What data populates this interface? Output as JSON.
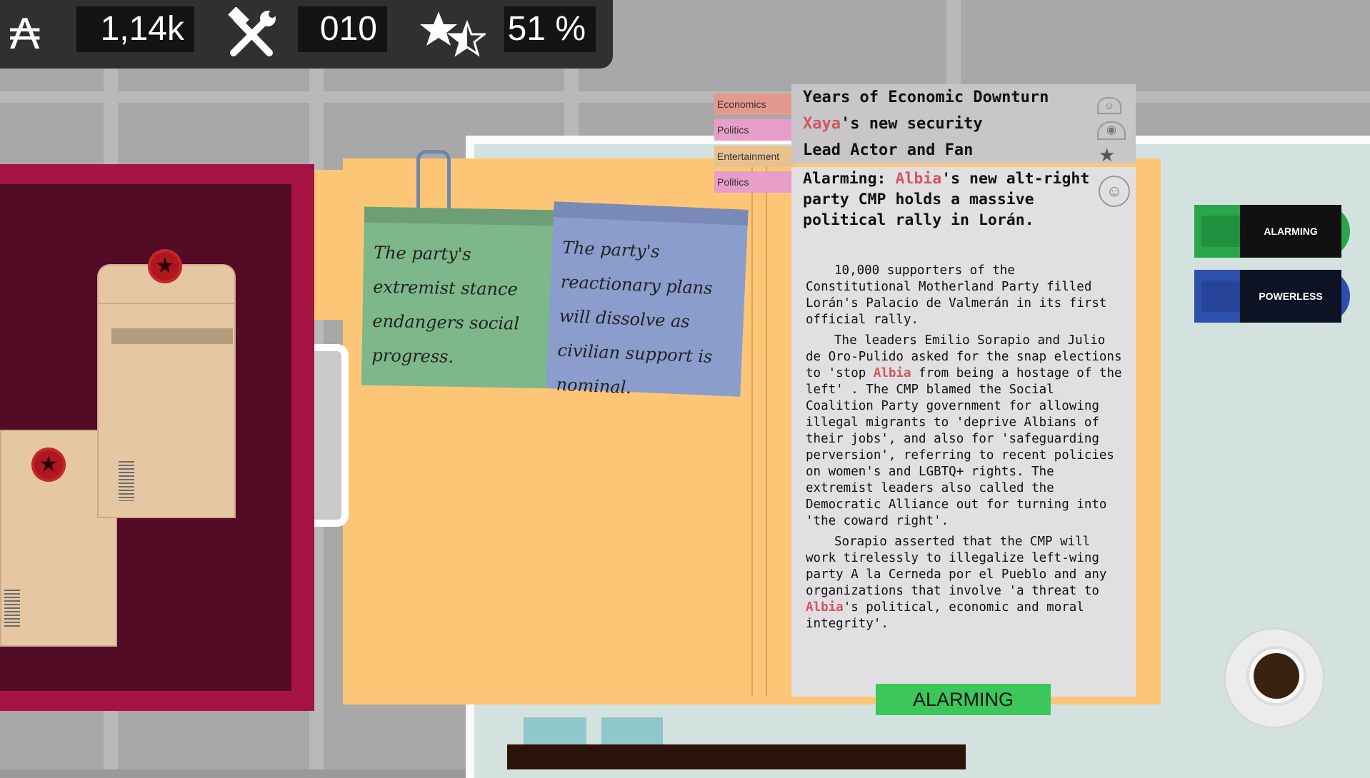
{
  "hud": {
    "money_icon": "austral-currency-icon",
    "money_symbol": "₳",
    "money_value": "1,14k",
    "tools_icon": "hammer-wrench-icon",
    "tools_value": "010",
    "rating_icon": "stars-icon",
    "rating_value": "51 %"
  },
  "notes": [
    {
      "text": "The party's extremist stance endangers social progress."
    },
    {
      "text": "The party's reactionary plans will dissolve as civilian support is nominal."
    }
  ],
  "categories": [
    {
      "label": "Economics",
      "color": "#e39a8c"
    },
    {
      "label": "Politics",
      "color": "#e79ec9"
    },
    {
      "label": "Entertainment",
      "color": "#e9c18e"
    },
    {
      "label": "Politics",
      "color": "#e79ec9"
    }
  ],
  "headlines": [
    {
      "text": "Years of Economic Downturn"
    },
    {
      "name": "Xaya",
      "text": "'s new security"
    },
    {
      "text": "Lead Actor and Fan"
    }
  ],
  "article": {
    "title_prefix": "Alarming: ",
    "title_country": "Albia",
    "title_suffix": "'s new alt-right party CMP holds a massive political rally in Lorán.",
    "p1": "10,000 supporters of the Constitutional Motherland Party filled Lorán's Palacio de Valmerán in its first official rally.",
    "p2a": "The leaders Emilio Sorapio and Julio de Oro-Pulido asked for the snap elections to 'stop ",
    "p2_country": "Albia",
    "p2b": " from being a hostage of the left' . The CMP blamed the Social Coalition Party government for allowing illegal migrants to 'deprive Albians of their jobs', and also for 'safeguarding perversion', referring to recent policies on women's and LGBTQ+ rights. The extremist leaders also called the Democratic Alliance out for turning into 'the coward right'.",
    "p3a": "Sorapio asserted that the CMP will work tirelessly to illegalize left-wing party A la Cerneda por el Pueblo and any organizations that involve 'a threat to ",
    "p3_country": "Albia",
    "p3b": "'s political, economic and moral integrity'."
  },
  "verdict": "ALARMING",
  "side_buttons": [
    {
      "label": "ALARMING",
      "color": "#2aa54b"
    },
    {
      "label": "POWERLESS",
      "color": "#2e4fae"
    }
  ],
  "coffee_icon": "coffee-cup-icon"
}
